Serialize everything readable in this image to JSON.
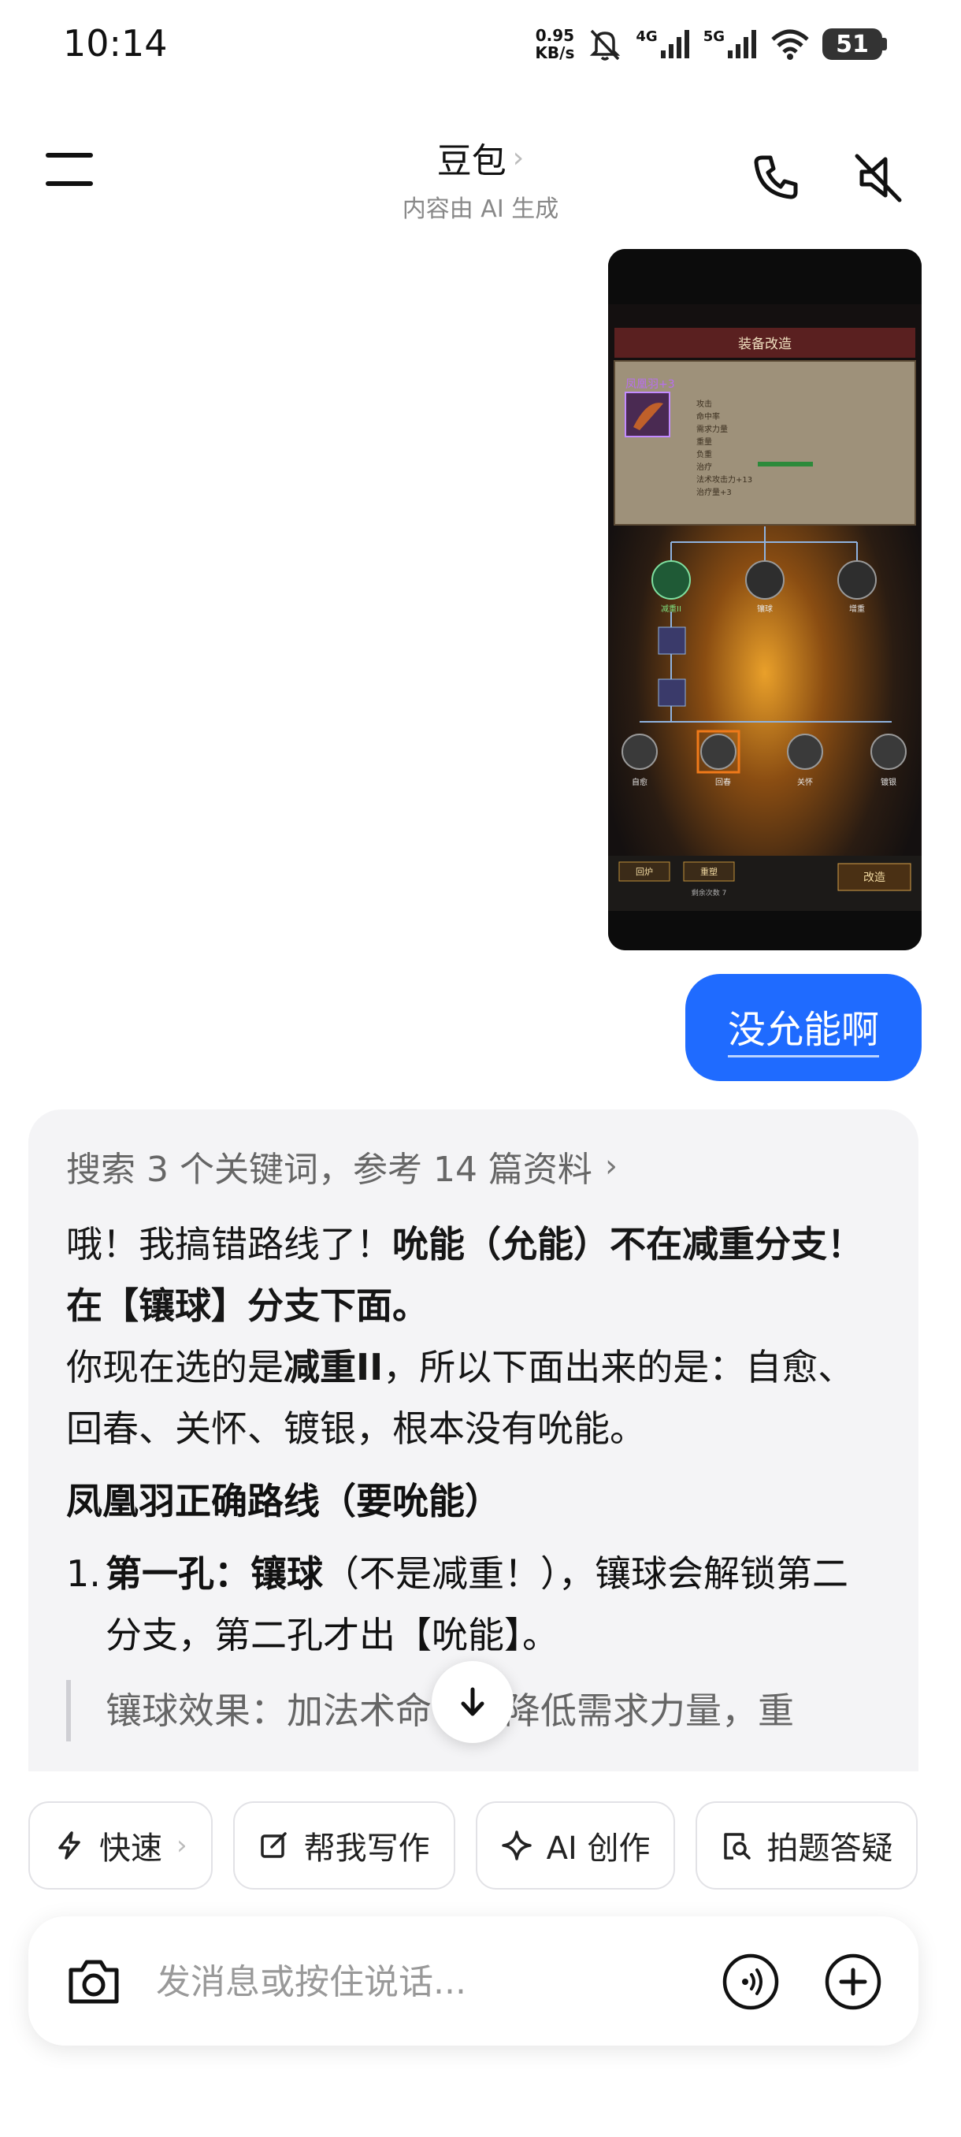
{
  "status_bar": {
    "time": "10:14",
    "net_speed_value": "0.95",
    "net_speed_unit": "KB/s",
    "signal_1": "4G",
    "signal_2": "5G",
    "battery": "51"
  },
  "header": {
    "title": "豆包",
    "subtitle": "内容由 AI 生成"
  },
  "chat": {
    "image_text": {
      "panel_title": "装备改造",
      "item_name": "凤凰羽+3",
      "stats": [
        "攻击",
        "命中率",
        "需求力量",
        "重量",
        "负重",
        "治疗",
        "法术攻击力+13",
        "治疗量+3"
      ],
      "nodes": [
        "减重II",
        "镶球",
        "增重"
      ],
      "bottom_nodes": [
        "自愈",
        "回春",
        "关怀",
        "镀银"
      ],
      "buttons": [
        "回炉",
        "重塑",
        "改造"
      ],
      "remaining": "剩余次数 7"
    },
    "user_message": "没允能啊",
    "answer": {
      "search_summary": "搜索 3 个关键词，参考 14 篇资料",
      "p1_a": "哦！我搞错路线了！",
      "p1_b": "吮能（允能）不在减重分支！在【镶球】分支下面。",
      "p2_a": "你现在选的是",
      "p2_b": "减重II",
      "p2_c": "，所以下面出来的是：自愈、回春、关怀、镀银，根本没有吮能。",
      "heading": "凤凰羽正确路线（要吮能）",
      "list_num": "1.",
      "list_bold": "第一孔：镶球",
      "list_rest": "（不是减重！），镶球会解锁第二分支，第二孔才出【吮能】。",
      "quote": "镶球效果：加法术命中，降低需求力量，重"
    }
  },
  "chips": {
    "fast": "快速",
    "write": "帮我写作",
    "ai_create": "AI 创作",
    "photo_answer": "拍题答疑"
  },
  "composer": {
    "placeholder": "发消息或按住说话..."
  },
  "colors": {
    "accent": "#1f6bff",
    "bubble_bg": "#f4f4f6"
  }
}
